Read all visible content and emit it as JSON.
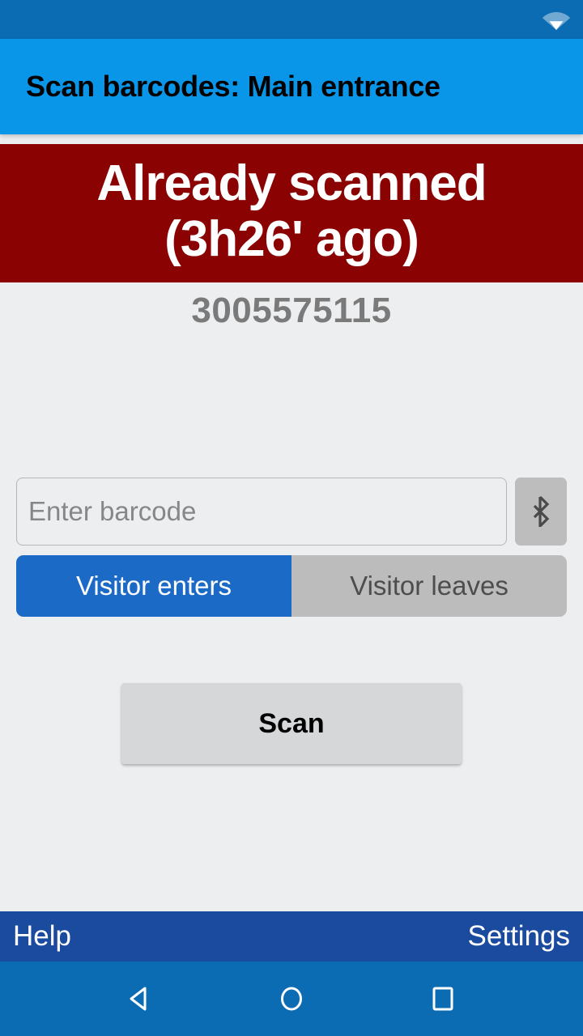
{
  "status_bar": {
    "wifi_icon": "wifi-icon"
  },
  "title_bar": {
    "title": "Scan barcodes: Main entrance"
  },
  "banner": {
    "line1": "Already scanned",
    "line2": "(3h26' ago)",
    "color": "#8a0202",
    "text_color": "#ffffff"
  },
  "scan_result": {
    "barcode_value": "3005575115"
  },
  "input_row": {
    "placeholder": "Enter barcode",
    "value": "",
    "bluetooth_icon": "bluetooth-icon"
  },
  "direction_toggle": {
    "options": [
      {
        "label": "Visitor enters",
        "selected": true
      },
      {
        "label": "Visitor leaves",
        "selected": false
      }
    ],
    "selected_color": "#1b6ac5",
    "unselected_color": "#bcbcbc"
  },
  "actions": {
    "scan_label": "Scan"
  },
  "bottom_bar": {
    "help_label": "Help",
    "settings_label": "Settings",
    "color": "#1a4b9e"
  },
  "nav_bar": {
    "back_icon": "back-triangle-icon",
    "home_icon": "home-circle-icon",
    "recents_icon": "recents-square-icon",
    "color": "#0b6cb3"
  },
  "theme": {
    "status_bar_color": "#0b6cb3",
    "title_bar_color": "#0a96e8",
    "page_background": "#edeef0"
  }
}
